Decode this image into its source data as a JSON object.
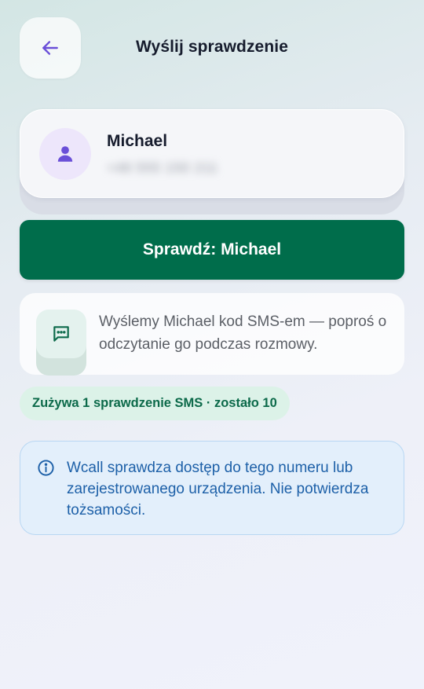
{
  "header": {
    "title": "Wyślij sprawdzenie",
    "back_icon": "arrow-left-icon"
  },
  "contact": {
    "name": "Michael",
    "phone": "+48 555 150 211",
    "phone_blurred": true,
    "avatar_icon": "person-icon"
  },
  "actions": {
    "verify_label": "Sprawdź: Michael"
  },
  "info": {
    "icon": "message-dots-icon",
    "text": "Wyślemy Michael kod SMS-em — poproś o odczytanie go podczas rozmowy."
  },
  "usage": {
    "text": "Zużywa 1 sprawdzenie SMS · zostało 10"
  },
  "notice": {
    "icon": "info-circle-icon",
    "text": "Wcall sprawdza dostęp do tego numeru lub zarejestrowanego urządzenia. Nie potwierdza tożsamości."
  },
  "colors": {
    "primary": "#006d4b",
    "accent_purple": "#6a4fd8",
    "info_blue": "#1d60a8",
    "badge_bg": "#dcf2e8"
  }
}
